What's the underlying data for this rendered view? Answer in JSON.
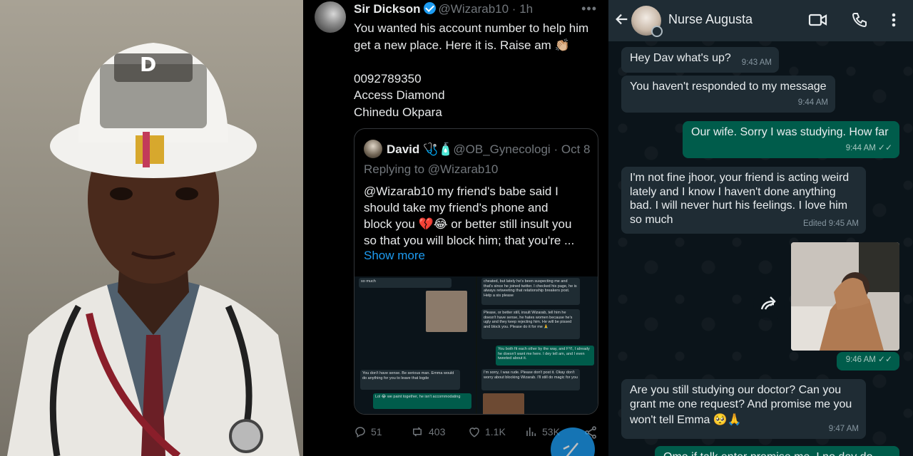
{
  "tweet": {
    "author_name": "Sir Dickson",
    "author_handle": "@Wizarab10",
    "age": "1h",
    "more": "•••",
    "body_lines": [
      "You wanted his account number to help him",
      "get a new place. Here it is. Raise am 👏🏼"
    ],
    "account_lines": [
      "0092789350",
      "Access Diamond",
      "Chinedu Okpara"
    ],
    "quote": {
      "name": "David",
      "name_emoji": "🩺🧴",
      "handle": "@OB_Gynecologi",
      "sep": "·",
      "date": "Oct 8",
      "replying": "Replying to @Wizarab10",
      "text_lines": [
        "@Wizarab10 my friend's babe said I",
        "should take my friend's phone and",
        "block you 💔😂 or better still insult you",
        "so that you will block him; that you're ..."
      ],
      "show_more": "Show more",
      "mini_left": [
        "so much",
        "You don't have sense. Be serious man. Emma would do anything for you to leave that logde",
        "Lol 😂 we paint together, he isn't accommodating"
      ],
      "mini_right": [
        "cheated, but lately he's been suspecting me and that's since he joined twitter. I checked his page, he is always retweeting that relationship breakers post. Help a sis please",
        "Please, or better still, insult Wizarab, tell him he doesn't have sense, he hates women because he's ugly and they keep rejecting him. He will be pissed and block you. Please do it for me 🙏",
        "You both fit each other by the way, and FYI, I already he doesn't want me here. I dey tell am, and I even tweeted about it.",
        "I'm sorry, I was rude. Please don't post it. Okay don't worry about blocking Wizarab. I'll still do magic for you"
      ]
    },
    "actions": {
      "replies": "51",
      "reposts": "403",
      "likes": "1.1K",
      "views": "53K"
    }
  },
  "chat": {
    "contact_name": "Nurse Augusta",
    "messages": [
      {
        "dir": "in",
        "lines": [
          "Hey Dav what's up?"
        ],
        "time": "9:43 AM"
      },
      {
        "dir": "in",
        "lines": [
          "You haven't responded to my message"
        ],
        "time": "9:44 AM"
      },
      {
        "dir": "out",
        "lines": [
          "Our wife. Sorry I was studying. How far"
        ],
        "time": "9:44 AM"
      },
      {
        "dir": "in",
        "lines": [
          "I'm not fine jhoor, your friend is acting weird",
          "lately and I know I haven't done anything",
          "bad. I will never hurt his feelings. I love him",
          "so much"
        ],
        "time": "9:45 AM",
        "edited": "Edited"
      },
      {
        "dir": "out",
        "lines": [],
        "time": "9:46 AM"
      },
      {
        "dir": "in",
        "lines": [
          "Are you still studying our doctor? Can you",
          "grant me one request? And promise me you",
          "won't tell Emma 🥺🙏"
        ],
        "time": "9:47 AM"
      },
      {
        "dir": "out",
        "lines": [
          "Omo if talk enter promise me. I no dey do"
        ],
        "time": ""
      }
    ]
  },
  "colors": {
    "twitter_blue": "#1d9bf0",
    "wa_incoming": "#1f2c34",
    "wa_outgoing": "#005c4b",
    "wa_bg": "#0b141a"
  }
}
